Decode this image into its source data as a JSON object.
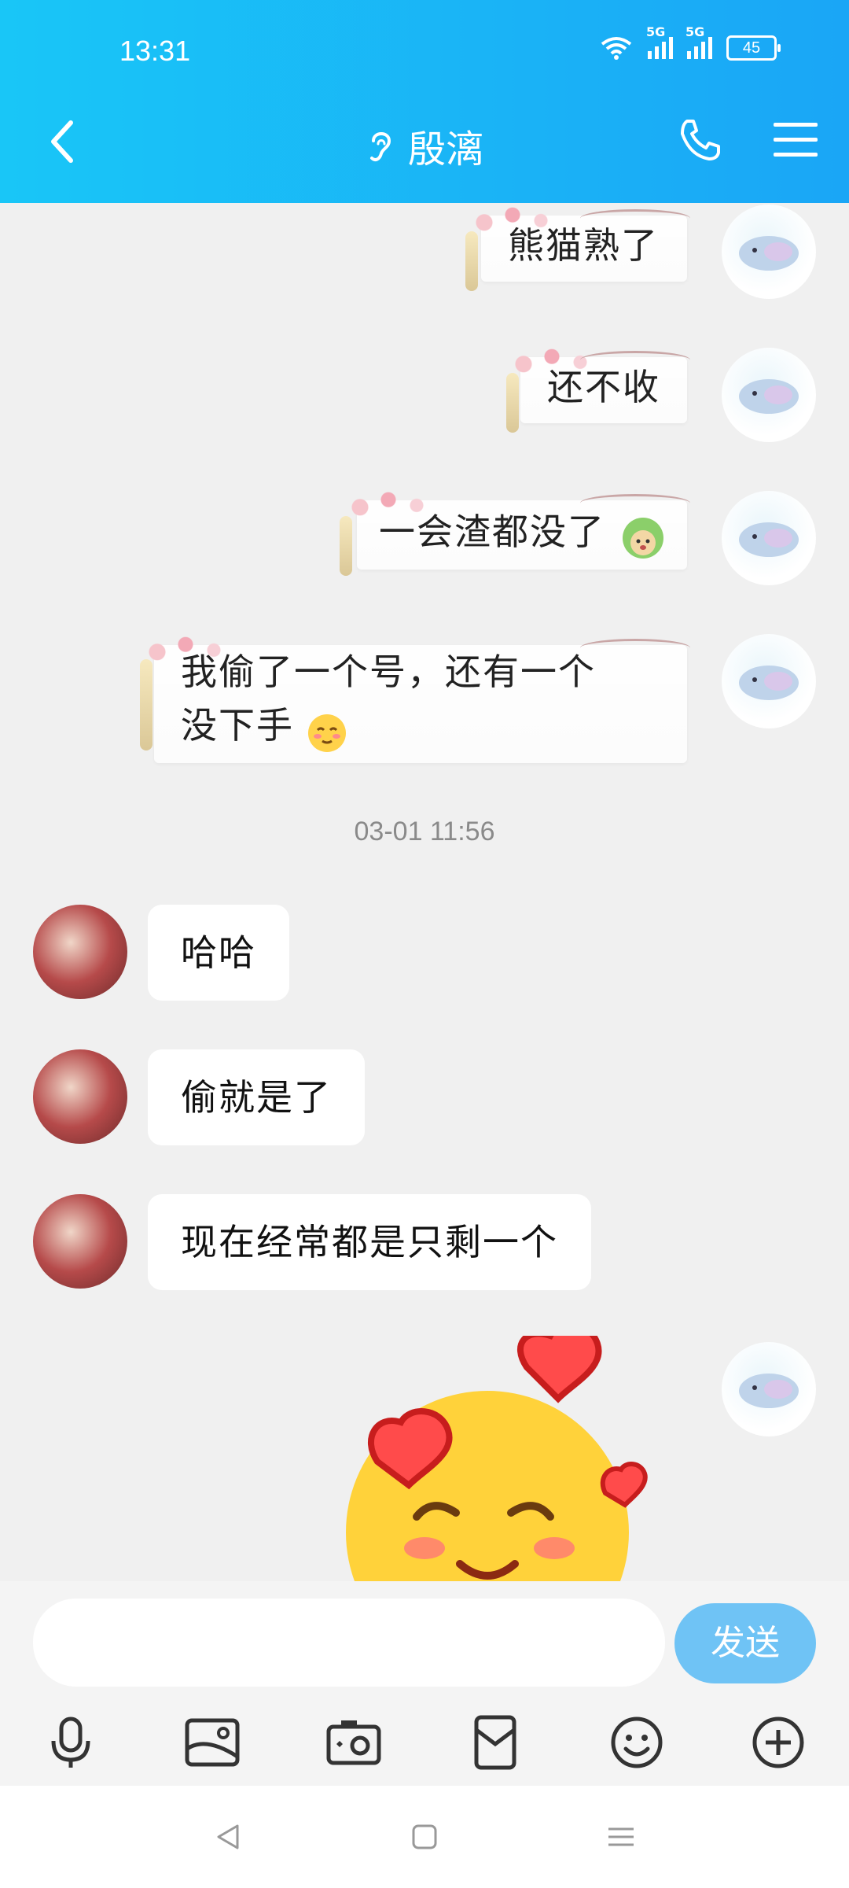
{
  "status_bar": {
    "time": "13:31",
    "network_1": "5G",
    "network_2": "5G",
    "battery": "45"
  },
  "header": {
    "title": "殷漓",
    "icons": [
      "back-icon",
      "ear-icon",
      "phone-icon",
      "menu-icon"
    ]
  },
  "messages": [
    {
      "side": "me",
      "text_lines": [
        "熊猫熟了"
      ]
    },
    {
      "side": "me",
      "text_lines": [
        "还不收"
      ]
    },
    {
      "side": "me",
      "text_lines": [
        "一会渣都没了"
      ],
      "emoji": "cabbage-dog"
    },
    {
      "side": "me",
      "text_lines": [
        "我偷了一个号，还有一个",
        "没下手"
      ],
      "emoji": "shy-face"
    },
    {
      "type": "timestamp",
      "text": "03-01 11:56"
    },
    {
      "side": "friend",
      "text_lines": [
        "哈哈"
      ]
    },
    {
      "side": "friend",
      "text_lines": [
        "偷就是了"
      ]
    },
    {
      "side": "friend",
      "text_lines": [
        "现在经常都是只剩一个"
      ]
    },
    {
      "side": "me",
      "type": "sticker",
      "sticker": "love-hearts-face"
    }
  ],
  "input": {
    "placeholder": "",
    "send_label": "发送"
  },
  "toolbar": [
    "mic-icon",
    "image-icon",
    "camera-icon",
    "red-packet-icon",
    "emoji-icon",
    "plus-icon"
  ],
  "colors": {
    "header_start": "#19c6f7",
    "header_end": "#1aa6f6",
    "send_button": "#6fc3f5",
    "background": "#f0f0f0"
  }
}
